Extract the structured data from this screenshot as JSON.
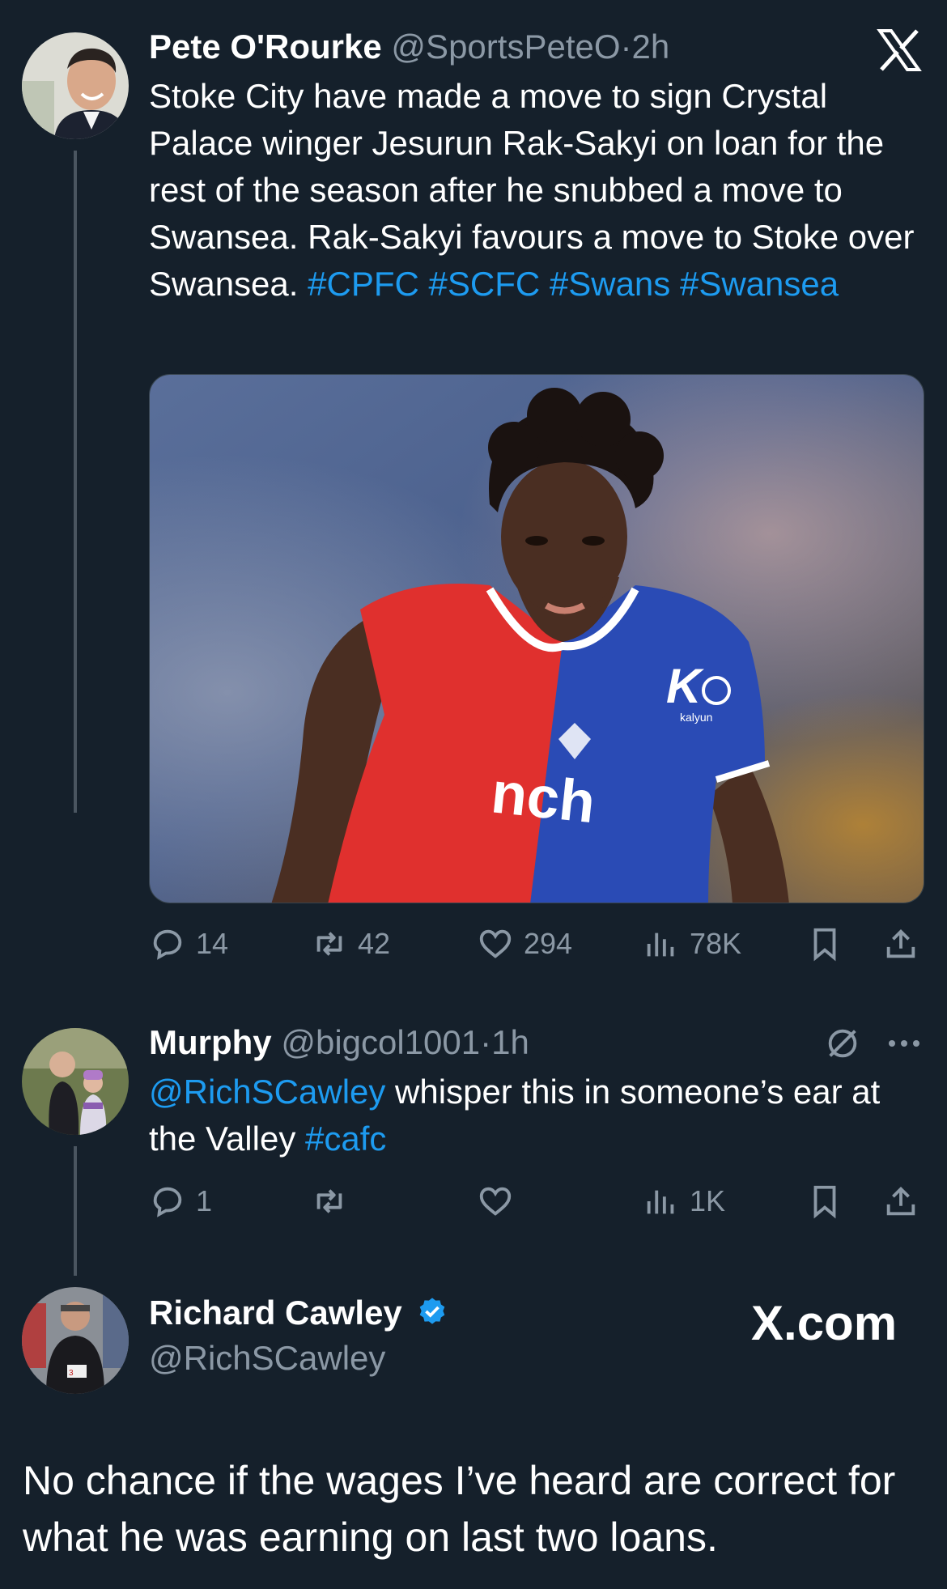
{
  "colors": {
    "background": "#15202b",
    "link": "#1d9bf0",
    "muted": "#8b98a5",
    "verified": "#1d9bf0"
  },
  "tweet1": {
    "name": "Pete O'Rourke",
    "handle": "@SportsPeteO",
    "sep": "·",
    "time": "2h",
    "text_a": "Stoke City have made a move to sign Crystal Palace winger Jesurun Rak-Sakyi on loan for the rest of the season after he snubbed a move to Swansea. Rak-Sakyi favours a move to Stoke over Swansea. ",
    "tags": [
      "#CPFC",
      "#SCFC",
      "#Swans",
      "#Swansea"
    ],
    "image_icon": "football-player-photo",
    "image_sponsor": "nch",
    "image_badge": "K",
    "image_badge_text": "kalyun",
    "stats": {
      "replies": "14",
      "reposts": "42",
      "likes": "294",
      "views": "78K"
    }
  },
  "tweet2": {
    "name": "Murphy",
    "handle": "@bigcol1001",
    "sep": "·",
    "time": "1h",
    "mention": "@RichSCawley",
    "text_a": " whisper this in someone’s ear at the Valley ",
    "tag": "#cafc",
    "stats": {
      "replies": "1",
      "reposts": "",
      "likes": "",
      "views": "1K"
    }
  },
  "tweet3": {
    "name": "Richard Cawley",
    "handle": "@RichSCawley",
    "brand": "X.com",
    "text": "No chance if the wages I’ve heard are correct for what he was earning on last two loans."
  }
}
